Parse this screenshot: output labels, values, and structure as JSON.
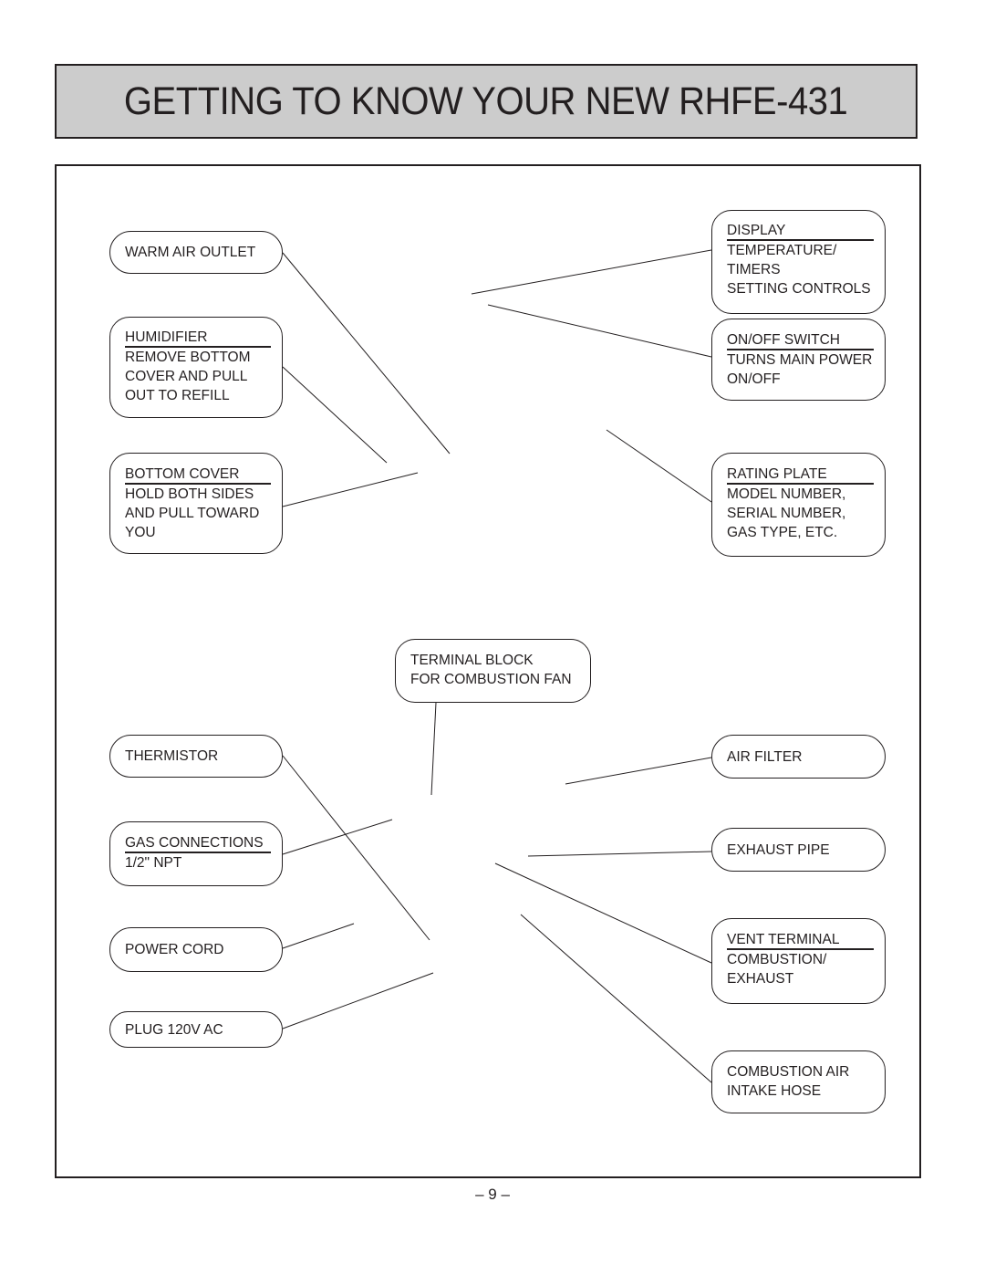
{
  "page": {
    "title": "GETTING TO KNOW YOUR NEW RHFE-431",
    "page_number": "– 9 –",
    "colors": {
      "title_background": "#cccccc",
      "ink": "#231f20",
      "paper": "#ffffff"
    }
  },
  "callouts": {
    "warm_air_outlet": {
      "lines": [
        "WARM AIR OUTLET"
      ]
    },
    "humidifier": {
      "heading": "HUMIDIFIER",
      "lines": [
        "REMOVE BOTTOM",
        "COVER AND PULL",
        "OUT TO REFILL"
      ]
    },
    "bottom_cover": {
      "heading": "BOTTOM COVER",
      "lines": [
        "HOLD BOTH SIDES",
        "AND PULL TOWARD",
        "YOU"
      ]
    },
    "display": {
      "heading": "DISPLAY",
      "lines": [
        "TEMPERATURE/",
        "TIMERS",
        "SETTING CONTROLS"
      ]
    },
    "on_off_switch": {
      "heading": "ON/OFF SWITCH",
      "lines": [
        "TURNS MAIN POWER",
        "ON/OFF"
      ]
    },
    "rating_plate": {
      "heading": "RATING PLATE",
      "lines": [
        "MODEL NUMBER,",
        "SERIAL NUMBER,",
        "GAS TYPE, ETC."
      ]
    },
    "terminal_block": {
      "lines": [
        "TERMINAL BLOCK",
        "FOR COMBUSTION FAN"
      ]
    },
    "thermistor": {
      "lines": [
        "THERMISTOR"
      ]
    },
    "gas_connections": {
      "heading": "GAS CONNECTIONS",
      "lines": [
        "1/2\" NPT"
      ]
    },
    "power_cord": {
      "lines": [
        "POWER CORD"
      ]
    },
    "plug": {
      "lines": [
        "PLUG 120V AC"
      ]
    },
    "air_filter": {
      "lines": [
        "AIR FILTER"
      ]
    },
    "exhaust_pipe": {
      "lines": [
        "EXHAUST PIPE"
      ]
    },
    "vent_terminal": {
      "heading": "VENT TERMINAL",
      "lines": [
        "COMBUSTION/",
        "EXHAUST"
      ]
    },
    "combustion_air_intake": {
      "lines": [
        "COMBUSTION AIR",
        "INTAKE HOSE"
      ]
    }
  }
}
